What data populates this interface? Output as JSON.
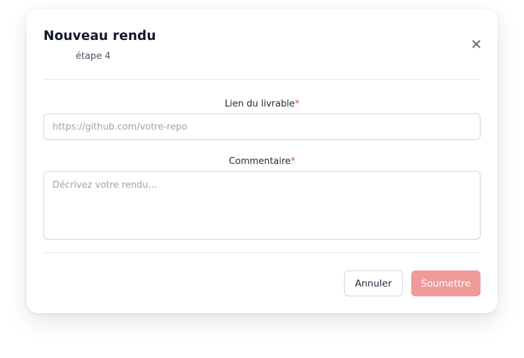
{
  "modal": {
    "title": "Nouveau rendu",
    "subtitle": "étape 4",
    "close_icon": "close-icon"
  },
  "form": {
    "link_label": "Lien du livrable",
    "link_required": "*",
    "link_placeholder": "https://github.com/votre-repo",
    "link_value": "",
    "comment_label": "Commentaire",
    "comment_required": "*",
    "comment_placeholder": "Décrivez votre rendu...",
    "comment_value": ""
  },
  "actions": {
    "cancel_label": "Annuler",
    "submit_label": "Soumettre"
  },
  "colors": {
    "required": "#ef4444",
    "submit_bg": "#f19a9a"
  }
}
